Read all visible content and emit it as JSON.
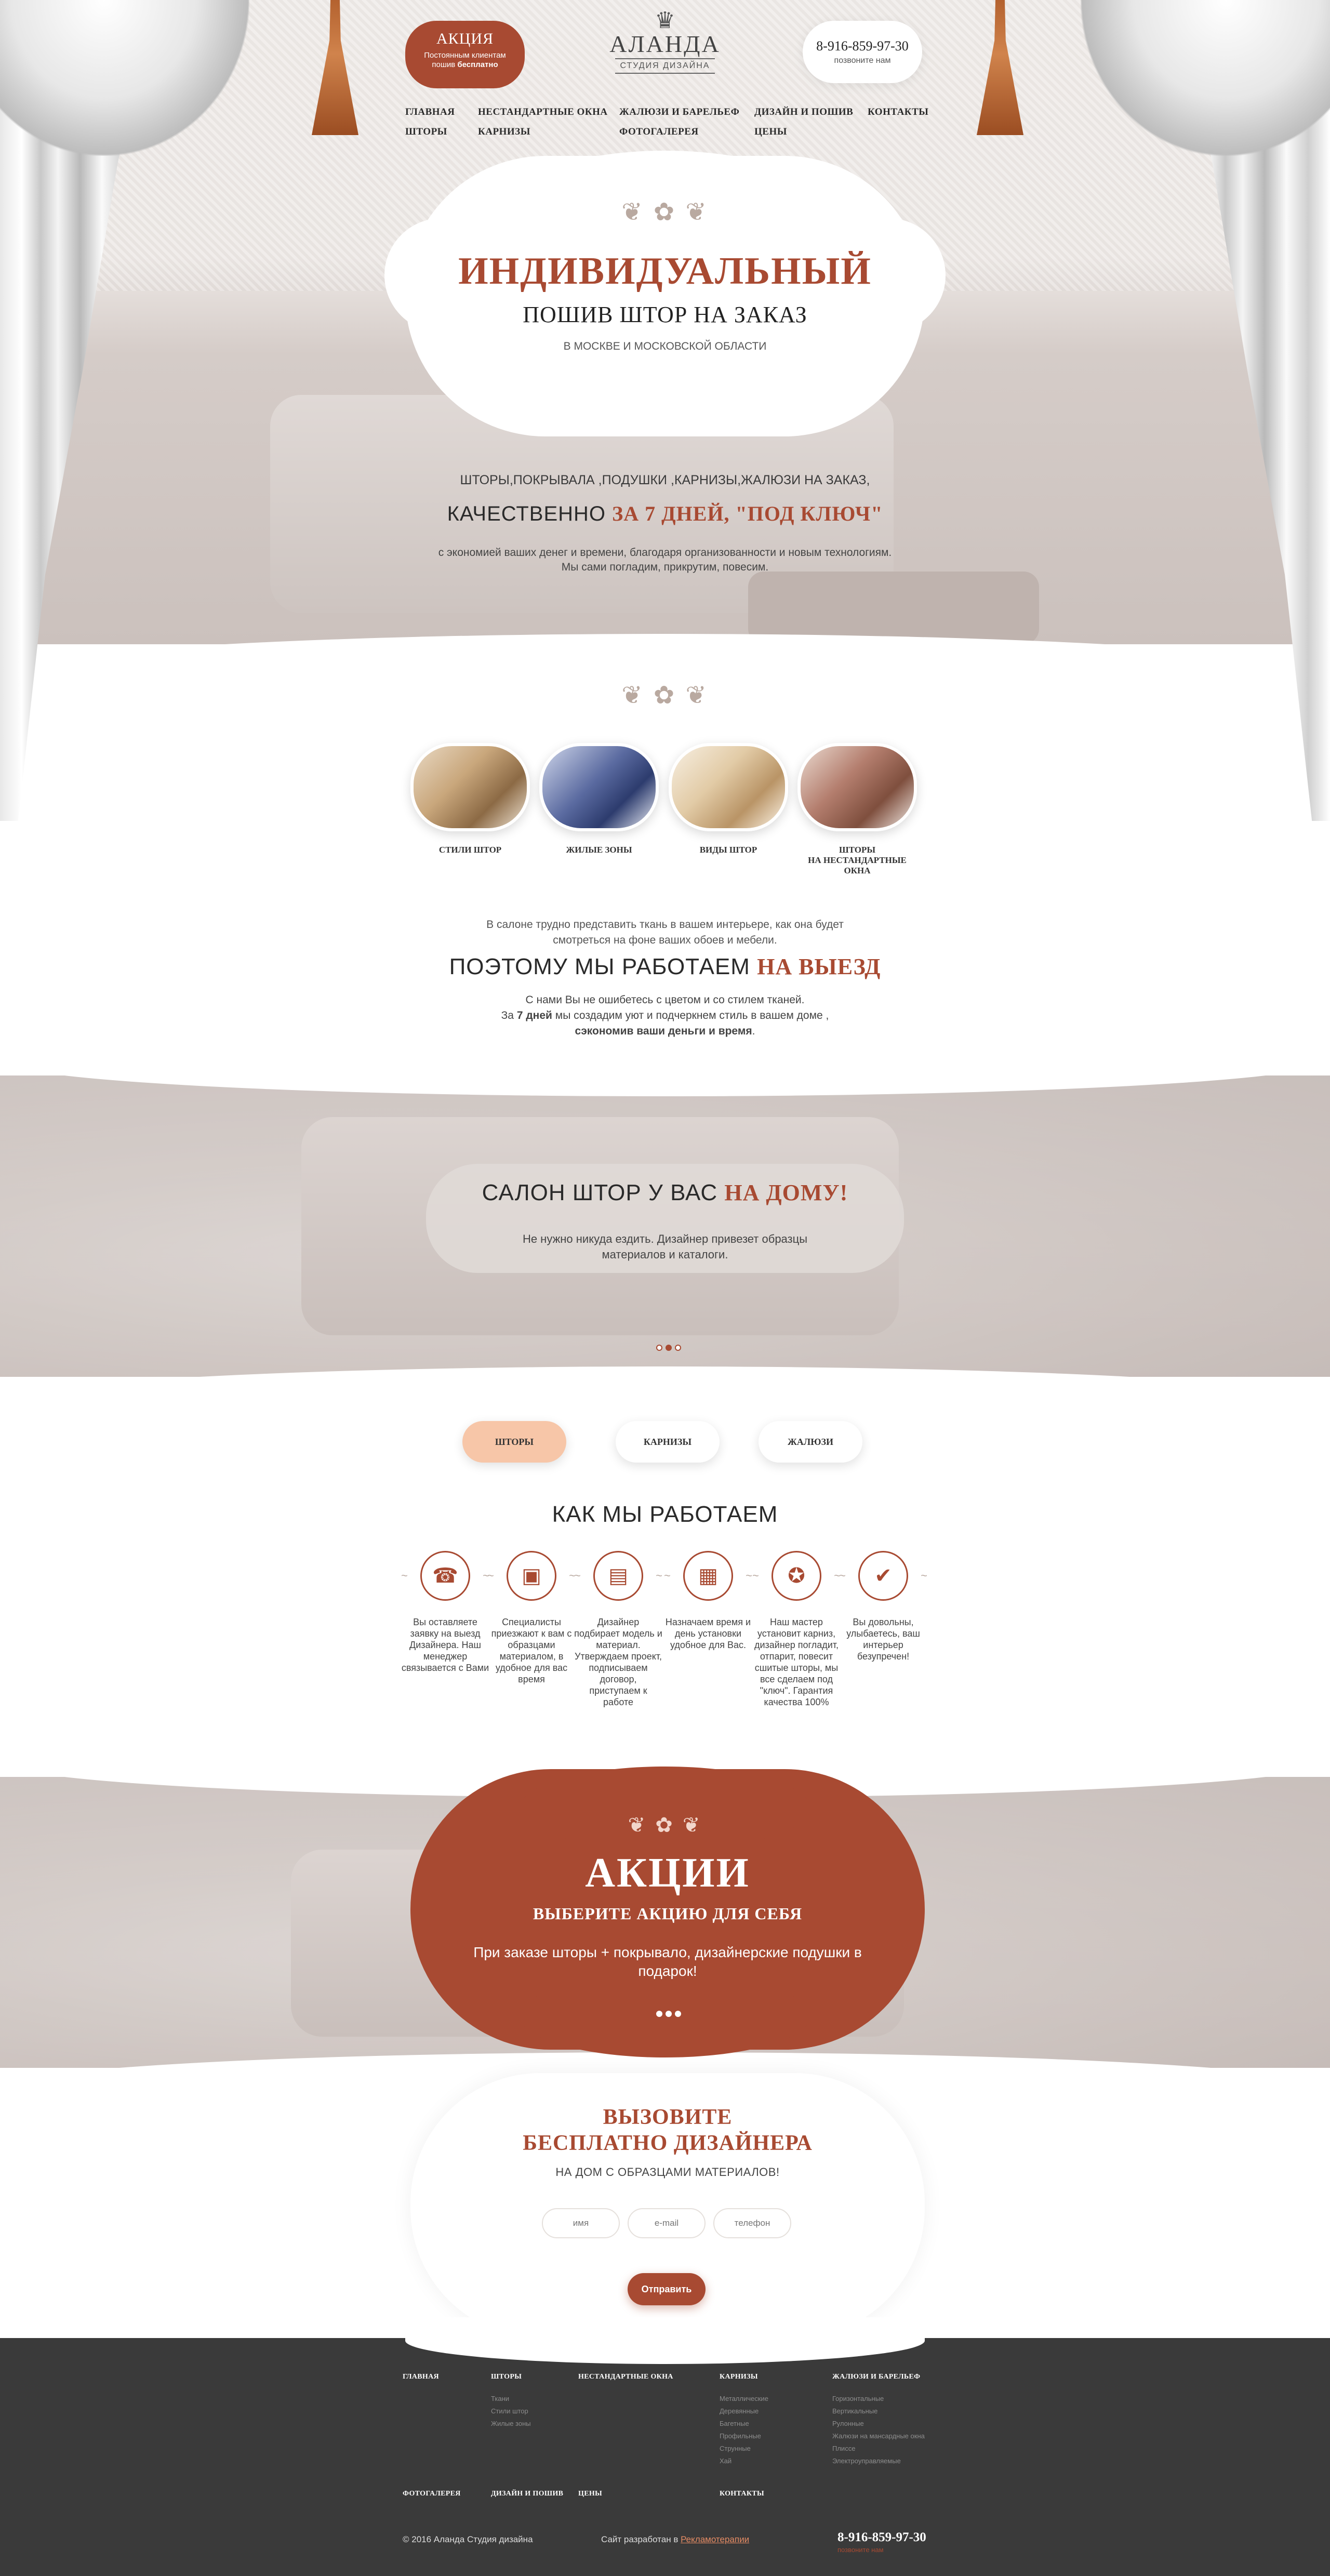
{
  "header": {
    "promo_badge": {
      "title": "АКЦИЯ",
      "line1": "Постоянным клиентам",
      "line2_pre": "пошив ",
      "line2_bold": "бесплатно"
    },
    "logo": {
      "name": "АЛАНДА",
      "subtitle": "СТУДИЯ ДИЗАЙНА"
    },
    "phone": {
      "number": "8-916-859-97-30",
      "caption": "позвоните нам"
    },
    "nav": [
      [
        "ГЛАВНАЯ",
        "ШТОРЫ"
      ],
      [
        "НЕСТАНДАРТНЫЕ ОКНА",
        "КАРНИЗЫ"
      ],
      [
        "ЖАЛЮЗИ И БАРЕЛЬЕФ",
        "ФОТОГАЛЕРЕЯ"
      ],
      [
        "ДИЗАЙН И ПОШИВ",
        "ЦЕНЫ"
      ],
      [
        "КОНТАКТЫ"
      ]
    ]
  },
  "hero": {
    "title": "ИНДИВИДУАЛЬНЫЙ",
    "subtitle": "ПОШИВ ШТОР НА ЗАКАЗ",
    "region": "В МОСКВЕ И МОСКОВСКОЙ ОБЛАСТИ",
    "list": "ШТОРЫ,ПОКРЫВАЛА ,ПОДУШКИ ,КАРНИЗЫ,ЖАЛЮЗИ НА ЗАКАЗ,",
    "quality_pre": "КАЧЕСТВЕННО ",
    "quality_accent": "ЗА 7 ДНЕЙ, \"ПОД КЛЮЧ\"",
    "text1": "с экономией ваших денег и времени, благодаря организованности и новым технологиям.",
    "text2": "Мы сами погладим, прикрутим, повесим."
  },
  "categories": [
    {
      "label": "СТИЛИ ШТОР"
    },
    {
      "label": "ЖИЛЫЕ ЗОНЫ"
    },
    {
      "label": "ВИДЫ ШТОР"
    },
    {
      "label": "ШТОРЫ\nНА НЕСТАНДАРТНЫЕ\nОКНА"
    }
  ],
  "intro": {
    "text1": "В салоне трудно представить ткань в вашем интерьере, как она будет",
    "text2": "смотреться на фоне ваших обоев и мебели.",
    "heading_pre": "ПОЭТОМУ МЫ РАБОТАЕМ ",
    "heading_accent": "НА ВЫЕЗД",
    "p1": "С нами Вы не ошибетесь с цветом и со стилем тканей.",
    "p2_pre": "За ",
    "p2_bold": "7 дней",
    "p2_post": " мы создадим уют и подчеркнем  стиль  в вашем доме ,",
    "p3_bold": "сэкономив ваши деньги и время",
    "p3_post": "."
  },
  "salon": {
    "title_pre": "САЛОН ШТОР У ВАС ",
    "title_accent": "НА ДОМУ!",
    "text1": "Не нужно никуда ездить. Дизайнер привезет образцы",
    "text2": "материалов и каталоги."
  },
  "tabs": [
    "ШТОРЫ",
    "КАРНИЗЫ",
    "ЖАЛЮЗИ"
  ],
  "how": {
    "title": "КАК МЫ РАБОТАЕМ",
    "steps": [
      {
        "icon": "phone-icon",
        "glyph": "☎",
        "text": "Вы оставляете заявку на выезд Дизайнера. Наш менеджер связывается с Вами"
      },
      {
        "icon": "briefcase-icon",
        "glyph": "▣",
        "text": "Специалисты приезжают к вам с образцами материалом, в удобное для вас время"
      },
      {
        "icon": "document-icon",
        "glyph": "▤",
        "text": "Дизайнер подбирает модель и материал. Утверждаем проект, подписываем договор, приступаем к работе"
      },
      {
        "icon": "calendar-icon",
        "glyph": "▦",
        "text": "Назначаем время и день установки удобное для Вас."
      },
      {
        "icon": "medal-icon",
        "glyph": "✪",
        "text": "Наш мастер установит карниз, дизайнер погладит, отпарит, повесит сшитые шторы, мы все сделаем под \"ключ\". Гарантия качества 100%"
      },
      {
        "icon": "thumbs-up-icon",
        "glyph": "✔",
        "text": "Вы довольны, улыбаетесь, ваш интерьер безупречен!"
      }
    ]
  },
  "promo": {
    "title": "АКЦИИ",
    "subtitle": "ВЫБЕРИТЕ АКЦИЮ ДЛЯ СЕБЯ",
    "text": "При заказе шторы + покрывало, дизайнерские подушки в подарок!"
  },
  "call": {
    "title_line1": "ВЫЗОВИТЕ",
    "title_line2": "БЕСПЛАТНО ДИЗАЙНЕРА",
    "subtitle": "НА ДОМ С ОБРАЗЦАМИ МАТЕРИАЛОВ!",
    "name_placeholder": "имя",
    "email_placeholder": "e-mail",
    "phone_placeholder": "телефон",
    "submit": "Отправить"
  },
  "footer": {
    "cols": [
      {
        "head": "ГЛАВНАЯ",
        "items": []
      },
      {
        "head": "ШТОРЫ",
        "items": [
          "Ткани",
          "Стили штор",
          "Жилые зоны"
        ]
      },
      {
        "head": "НЕСТАНДАРТНЫЕ ОКНА",
        "items": []
      },
      {
        "head": "КАРНИЗЫ",
        "items": [
          "Металлические",
          "Деревянные",
          "Багетные",
          "Профильные",
          "Струнные",
          "Хай"
        ]
      },
      {
        "head": "ЖАЛЮЗИ И БАРЕЛЬЕФ",
        "items": [
          "Горизонтальные",
          "Вертикальные",
          "Рулонные",
          "Жалюзи на мансардные окна",
          "Плиссе",
          "Электроуправляемые"
        ]
      }
    ],
    "row2": [
      "ФОТОГАЛЕРЕЯ",
      "ДИЗАЙН И ПОШИВ",
      "ЦЕНЫ",
      "КОНТАКТЫ"
    ],
    "copyright": "© 2016 Аланда Студия дизайна",
    "dev_pre": "Сайт разработан в ",
    "dev_link": "Рекламотерапии",
    "phone": "8-916-859-97-30",
    "phone_caption": "позвоните нам"
  },
  "colors": {
    "accent": "#a84a32",
    "peach": "#f7c6a8",
    "footer": "#3a3a3a"
  }
}
